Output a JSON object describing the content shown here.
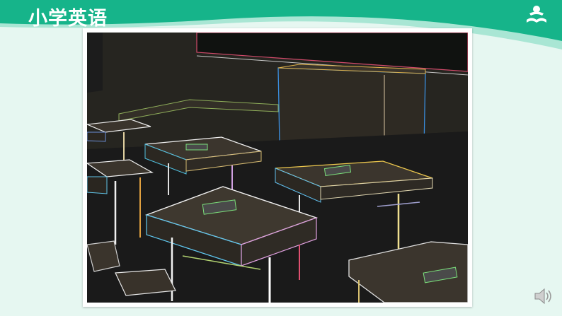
{
  "header": {
    "title": "小学英语",
    "accent_color": "#16b48a",
    "logo_icon": "book-reader-logo-icon"
  },
  "slide": {
    "image_icon": "classroom-desks-edge-image"
  },
  "controls": {
    "audio_icon": "speaker-icon"
  }
}
